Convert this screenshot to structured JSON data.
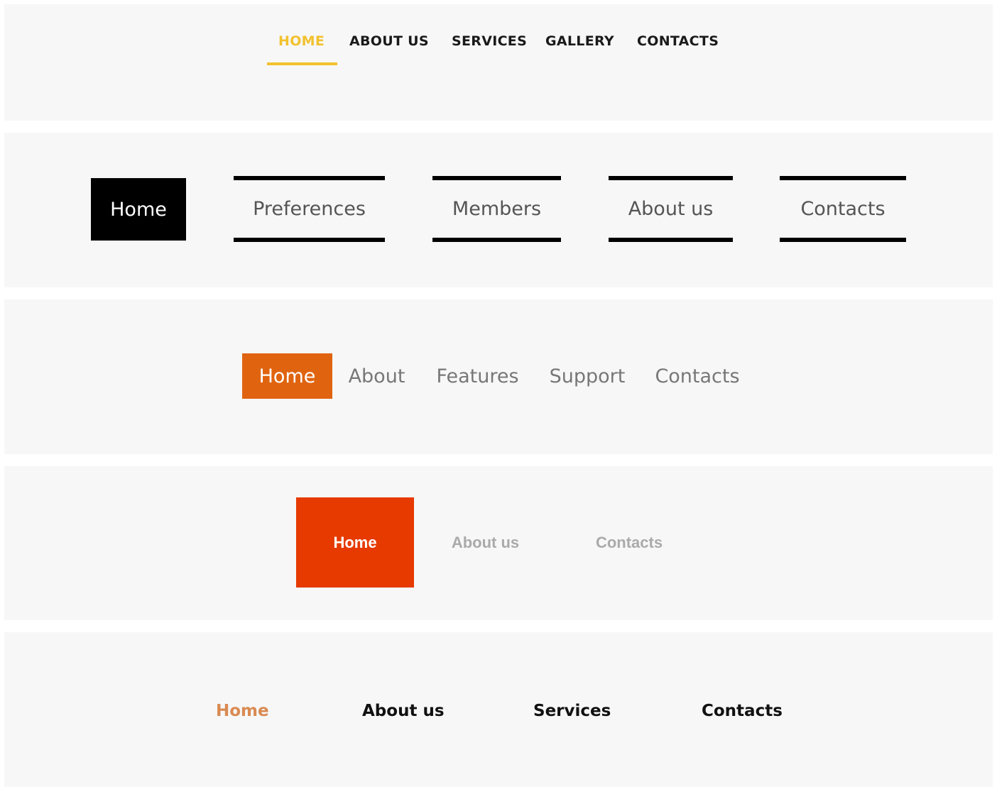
{
  "colors": {
    "panel_background": "#f7f7f7",
    "menu1_accent": "#f2c12e",
    "menu2_active_bg": "#000000",
    "menu3_active_bg": "#e06410",
    "menu4_active_bg": "#e63a00",
    "menu5_active_text": "#d98a52"
  },
  "menu1": {
    "items": [
      {
        "label": "HOME",
        "active": true
      },
      {
        "label": "ABOUT US",
        "active": false
      },
      {
        "label": "SERVICES",
        "active": false
      },
      {
        "label": "GALLERY",
        "active": false
      },
      {
        "label": "CONTACTS",
        "active": false
      }
    ]
  },
  "menu2": {
    "items": [
      {
        "label": "Home",
        "active": true
      },
      {
        "label": "Preferences",
        "active": false
      },
      {
        "label": "Members",
        "active": false
      },
      {
        "label": "About us",
        "active": false
      },
      {
        "label": "Contacts",
        "active": false
      }
    ]
  },
  "menu3": {
    "items": [
      {
        "label": "Home",
        "active": true
      },
      {
        "label": "About",
        "active": false
      },
      {
        "label": "Features",
        "active": false
      },
      {
        "label": "Support",
        "active": false
      },
      {
        "label": "Contacts",
        "active": false
      }
    ]
  },
  "menu4": {
    "items": [
      {
        "label": "Home",
        "active": true
      },
      {
        "label": "About us",
        "active": false
      },
      {
        "label": "Contacts",
        "active": false
      }
    ]
  },
  "menu5": {
    "items": [
      {
        "label": "Home",
        "active": true
      },
      {
        "label": "About us",
        "active": false
      },
      {
        "label": "Services",
        "active": false
      },
      {
        "label": "Contacts",
        "active": false
      }
    ]
  }
}
